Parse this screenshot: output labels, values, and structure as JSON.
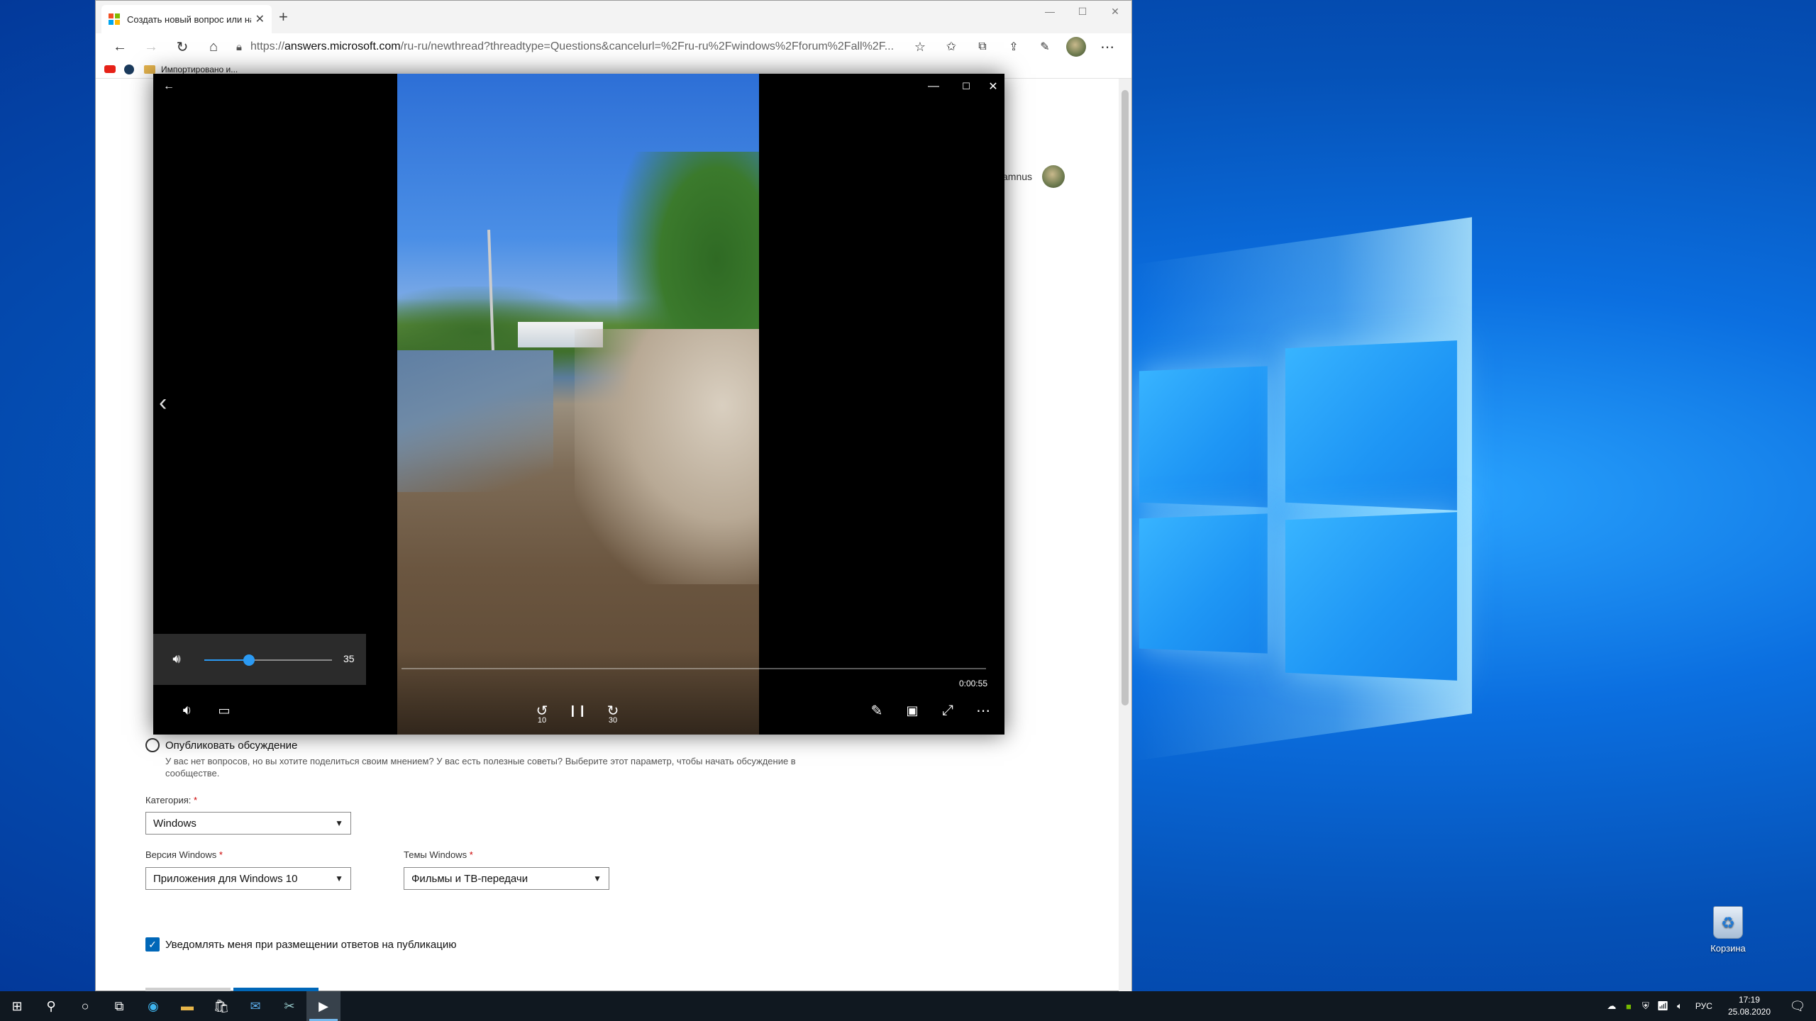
{
  "browser": {
    "tab_title": "Создать новый вопрос или на",
    "new_tab": "+",
    "url_prefix": "https://",
    "url_host": "answers.microsoft.com",
    "url_rest": "/ru-ru/newthread?threadtype=Questions&cancelurl=%2Fru-ru%2Fwindows%2Fforum%2Fall%2F...",
    "favorites": {
      "imported": "Импортировано и..."
    },
    "accent": "#0067b8"
  },
  "page": {
    "user_name": "amnus",
    "publish_discussion": "Опубликовать обсуждение",
    "publish_help_1": "У вас нет вопросов, но вы хотите поделиться своим мнением? У вас есть полезные советы? Выберите этот параметр, чтобы начать обсуждение в",
    "publish_help_2": "сообществе.",
    "category_label": "Категория:",
    "category_value": "Windows",
    "version_label": "Версия Windows",
    "version_value": "Приложения для Windows 10",
    "topic_label": "Темы Windows",
    "topic_value": "Фильмы и ТВ-передачи",
    "required_mark": "*",
    "notify_label": "Уведомлять меня при размещении ответов на публикацию"
  },
  "player": {
    "volume_value": 35,
    "volume_text": "35",
    "volume_fraction": 0.35,
    "time": "0:00:55",
    "skip_back": "10",
    "skip_forward": "30",
    "accent": "#2b9af3"
  },
  "desktop": {
    "recycle_bin": "Корзина"
  },
  "taskbar": {
    "language": "РУС",
    "time": "17:19",
    "date": "25.08.2020"
  }
}
